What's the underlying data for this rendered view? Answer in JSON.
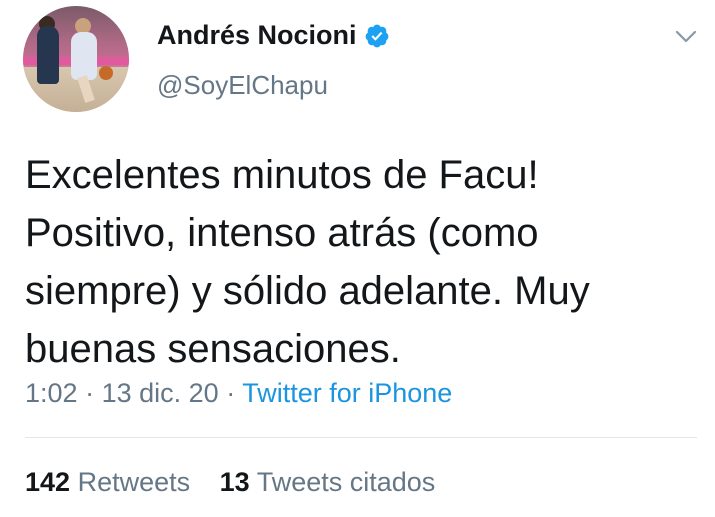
{
  "author": {
    "name": "Andrés Nocioni",
    "handle": "@SoyElChapu",
    "verified": true
  },
  "tweet": {
    "text": "Excelentes minutos de Facu! Positivo, intenso atrás (como siempre) y sólido adelante. Muy buenas sensaciones.",
    "time": "1:02",
    "date": "13 dic. 20",
    "separator": "·",
    "source": "Twitter for iPhone"
  },
  "stats": {
    "retweets_count": "142",
    "retweets_label": "Retweets",
    "quotes_count": "13",
    "quotes_label": "Tweets citados"
  },
  "icons": {
    "verified": "verified-badge-icon",
    "menu": "chevron-down-icon"
  },
  "colors": {
    "text": "#14171a",
    "secondary": "#657786",
    "link": "#1b95e0",
    "verified": "#1da1f2",
    "divider": "#e1e8ed"
  }
}
